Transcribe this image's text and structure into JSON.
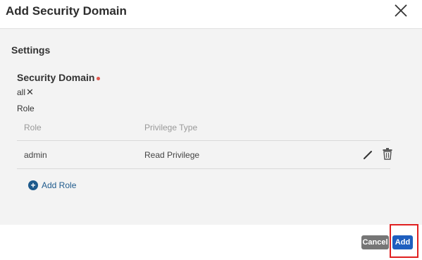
{
  "dialog": {
    "title": "Add Security Domain"
  },
  "settings": {
    "heading": "Settings",
    "security_domain_label": "Security Domain",
    "selected_domain": "all",
    "role_label": "Role"
  },
  "table": {
    "headers": [
      "Role",
      "Privilege Type"
    ],
    "rows": [
      {
        "role": "admin",
        "privilege": "Read Privilege"
      }
    ]
  },
  "add_role_label": "Add Role",
  "footer": {
    "cancel_label": "Cancel",
    "add_label": "Add"
  },
  "colors": {
    "primary": "#1f5fbf",
    "link": "#1e5a8c",
    "required": "#e0584e",
    "highlight": "#e02020"
  },
  "icons": {
    "close": "close-icon",
    "remove_chip": "close-icon",
    "edit": "pencil-icon",
    "delete": "trash-icon",
    "add": "plus-circle-icon"
  }
}
